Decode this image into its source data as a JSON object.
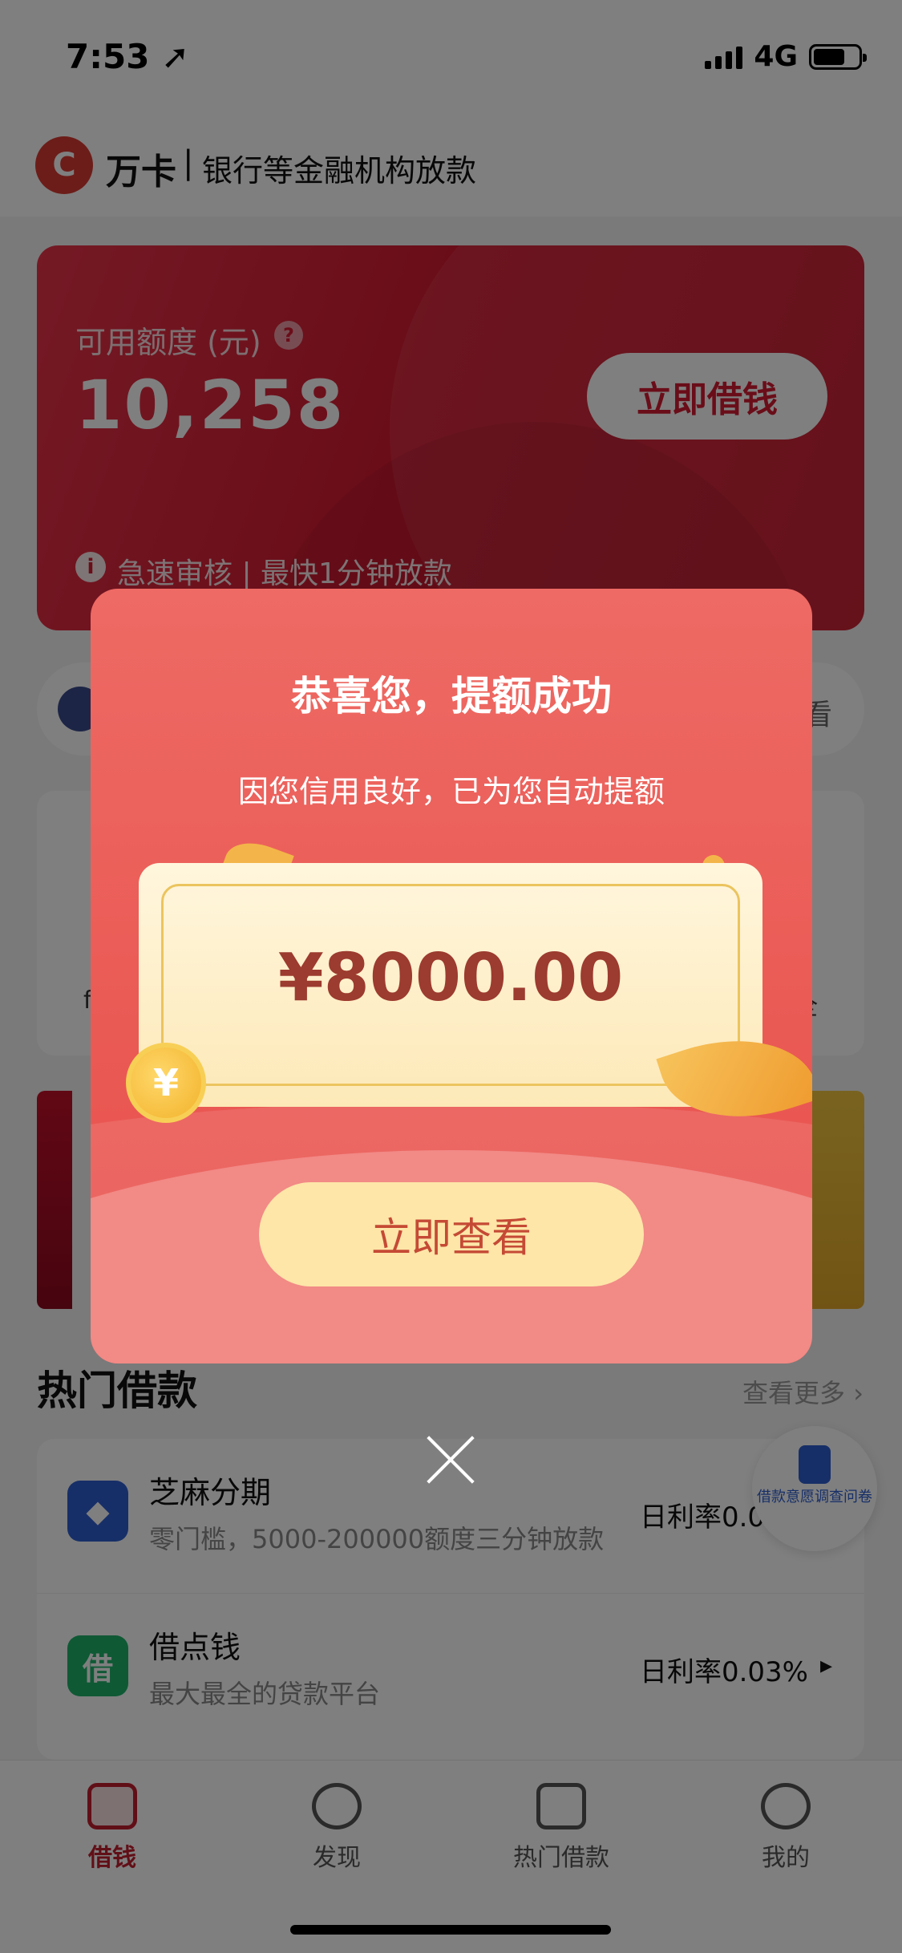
{
  "status_bar": {
    "time": "7:53 ➚",
    "network": "4G"
  },
  "header": {
    "logo_glyph": "C",
    "brand": "万卡",
    "separator": "|",
    "tagline": "银行等金融机构放款"
  },
  "credit_card": {
    "label": "可用额度 (元)",
    "amount": "10,258",
    "borrow_button": "立即借钱",
    "note": "急速审核 | 最快1分钟放款"
  },
  "notice": {
    "right_text": "看"
  },
  "features": {
    "left_fragment": "f",
    "right_fragment": "全"
  },
  "hot_loans": {
    "title": "热门借款",
    "see_more": "查看更多 ›",
    "items": [
      {
        "name": "芝麻分期",
        "desc": "零门槛，5000-200000额度三分钟放款",
        "rate": "日利率0.01%",
        "logo_color": "#2f5fd0"
      },
      {
        "name": "借点钱",
        "desc": "最大最全的贷款平台",
        "rate": "日利率0.03%",
        "logo_color": "#1fb36a",
        "logo_glyph": "借"
      }
    ]
  },
  "survey": {
    "label": "借款意愿调查问卷"
  },
  "tabs": [
    {
      "label": "借钱",
      "active": true
    },
    {
      "label": "发现",
      "active": false
    },
    {
      "label": "热门借款",
      "active": false
    },
    {
      "label": "我的",
      "active": false
    }
  ],
  "modal": {
    "title": "恭喜您，提额成功",
    "subtitle": "因您信用良好，已为您自动提额",
    "amount": "¥8000.00",
    "coin_glyph": "¥",
    "view_button": "立即查看"
  },
  "colors": {
    "brand_red": "#d41a32",
    "modal_red": "#ea5954",
    "gold": "#f3b549"
  }
}
